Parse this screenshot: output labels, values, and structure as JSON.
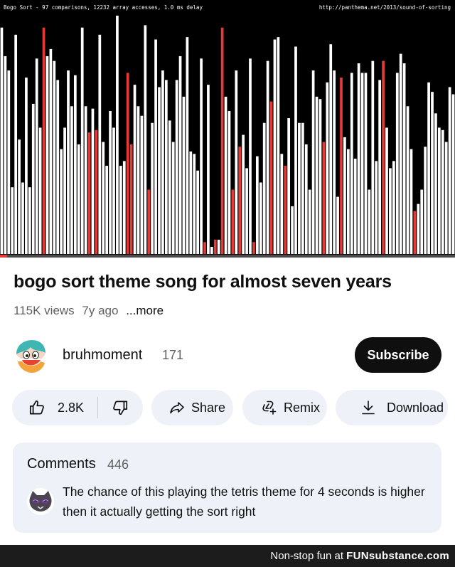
{
  "video": {
    "overlay_left": "Bogo Sort - 97 comparisons, 12232 array accesses, 1.0 ms delay",
    "overlay_right": "http://panthema.net/2013/sound-of-sorting",
    "bar_color": "#ffffff",
    "highlight_color": "#e53935",
    "bar_levels": [
      0.95,
      0.83,
      0.77,
      0.28,
      0.92,
      0.48,
      0.3,
      0.74,
      0.28,
      0.63,
      0.82,
      0.53,
      0.95,
      0.83,
      0.86,
      0.81,
      0.73,
      0.44,
      0.53,
      0.77,
      0.62,
      0.75,
      0.46,
      0.95,
      0.62,
      0.51,
      0.61,
      0.52,
      0.92,
      0.47,
      0.37,
      0.6,
      0.53,
      1.0,
      0.37,
      0.39,
      0.76,
      0.46,
      0.71,
      0.62,
      0.58,
      0.96,
      0.27,
      0.55,
      0.9,
      0.7,
      0.77,
      0.73,
      0.56,
      0.47,
      0.73,
      0.83,
      0.66,
      0.91,
      0.43,
      0.42,
      0.35,
      0.82,
      0.05,
      0.71,
      0.03,
      0.06,
      0.06,
      0.95,
      0.66,
      0.6,
      0.27,
      0.77,
      0.45,
      0.5,
      0.36,
      0.82,
      0.05,
      0.41,
      0.3,
      0.55,
      0.81,
      0.64,
      0.9,
      0.91,
      0.42,
      0.37,
      0.57,
      0.2,
      0.87,
      0.55,
      0.55,
      0.46,
      0.27,
      0.77,
      0.66,
      0.65,
      0.47,
      0.72,
      0.88,
      0.77,
      0.24,
      0.74,
      0.49,
      0.44,
      0.76,
      0.4,
      0.8,
      0.76,
      0.76,
      0.27,
      0.81,
      0.39,
      0.73,
      0.81,
      0.53,
      0.36,
      0.39,
      0.76,
      0.84,
      0.8,
      0.62,
      0.44,
      0.18,
      0.21,
      0.27,
      0.45,
      0.72,
      0.68,
      0.59,
      0.53,
      0.52,
      0.47,
      0.7,
      0.67
    ],
    "highlight_indices": [
      12,
      25,
      27,
      36,
      37,
      42,
      58,
      61,
      63,
      66,
      68,
      72,
      77,
      81,
      92,
      97,
      109,
      118
    ],
    "progress": 0.016
  },
  "title": "bogo sort theme song for almost seven years",
  "meta": {
    "views": "115K views",
    "age": "7y ago",
    "more": "...more"
  },
  "channel": {
    "name": "bruhmoment",
    "subscribers": "171",
    "subscribe_label": "Subscribe"
  },
  "actions": {
    "likes": "2.8K",
    "share": "Share",
    "remix": "Remix",
    "download": "Download"
  },
  "comments": {
    "title": "Comments",
    "count": "446",
    "top_comment": "The chance of this playing the tetris theme for 4 seconds is higher then it actually getting the sort right"
  },
  "footer": {
    "prefix": "Non-stop fun at ",
    "brand": "FUNsubstance.com"
  },
  "icons": {
    "like": "thumbs-up-icon",
    "dislike": "thumbs-down-icon",
    "share": "share-arrow-icon",
    "remix": "remix-icon",
    "download": "download-icon"
  }
}
